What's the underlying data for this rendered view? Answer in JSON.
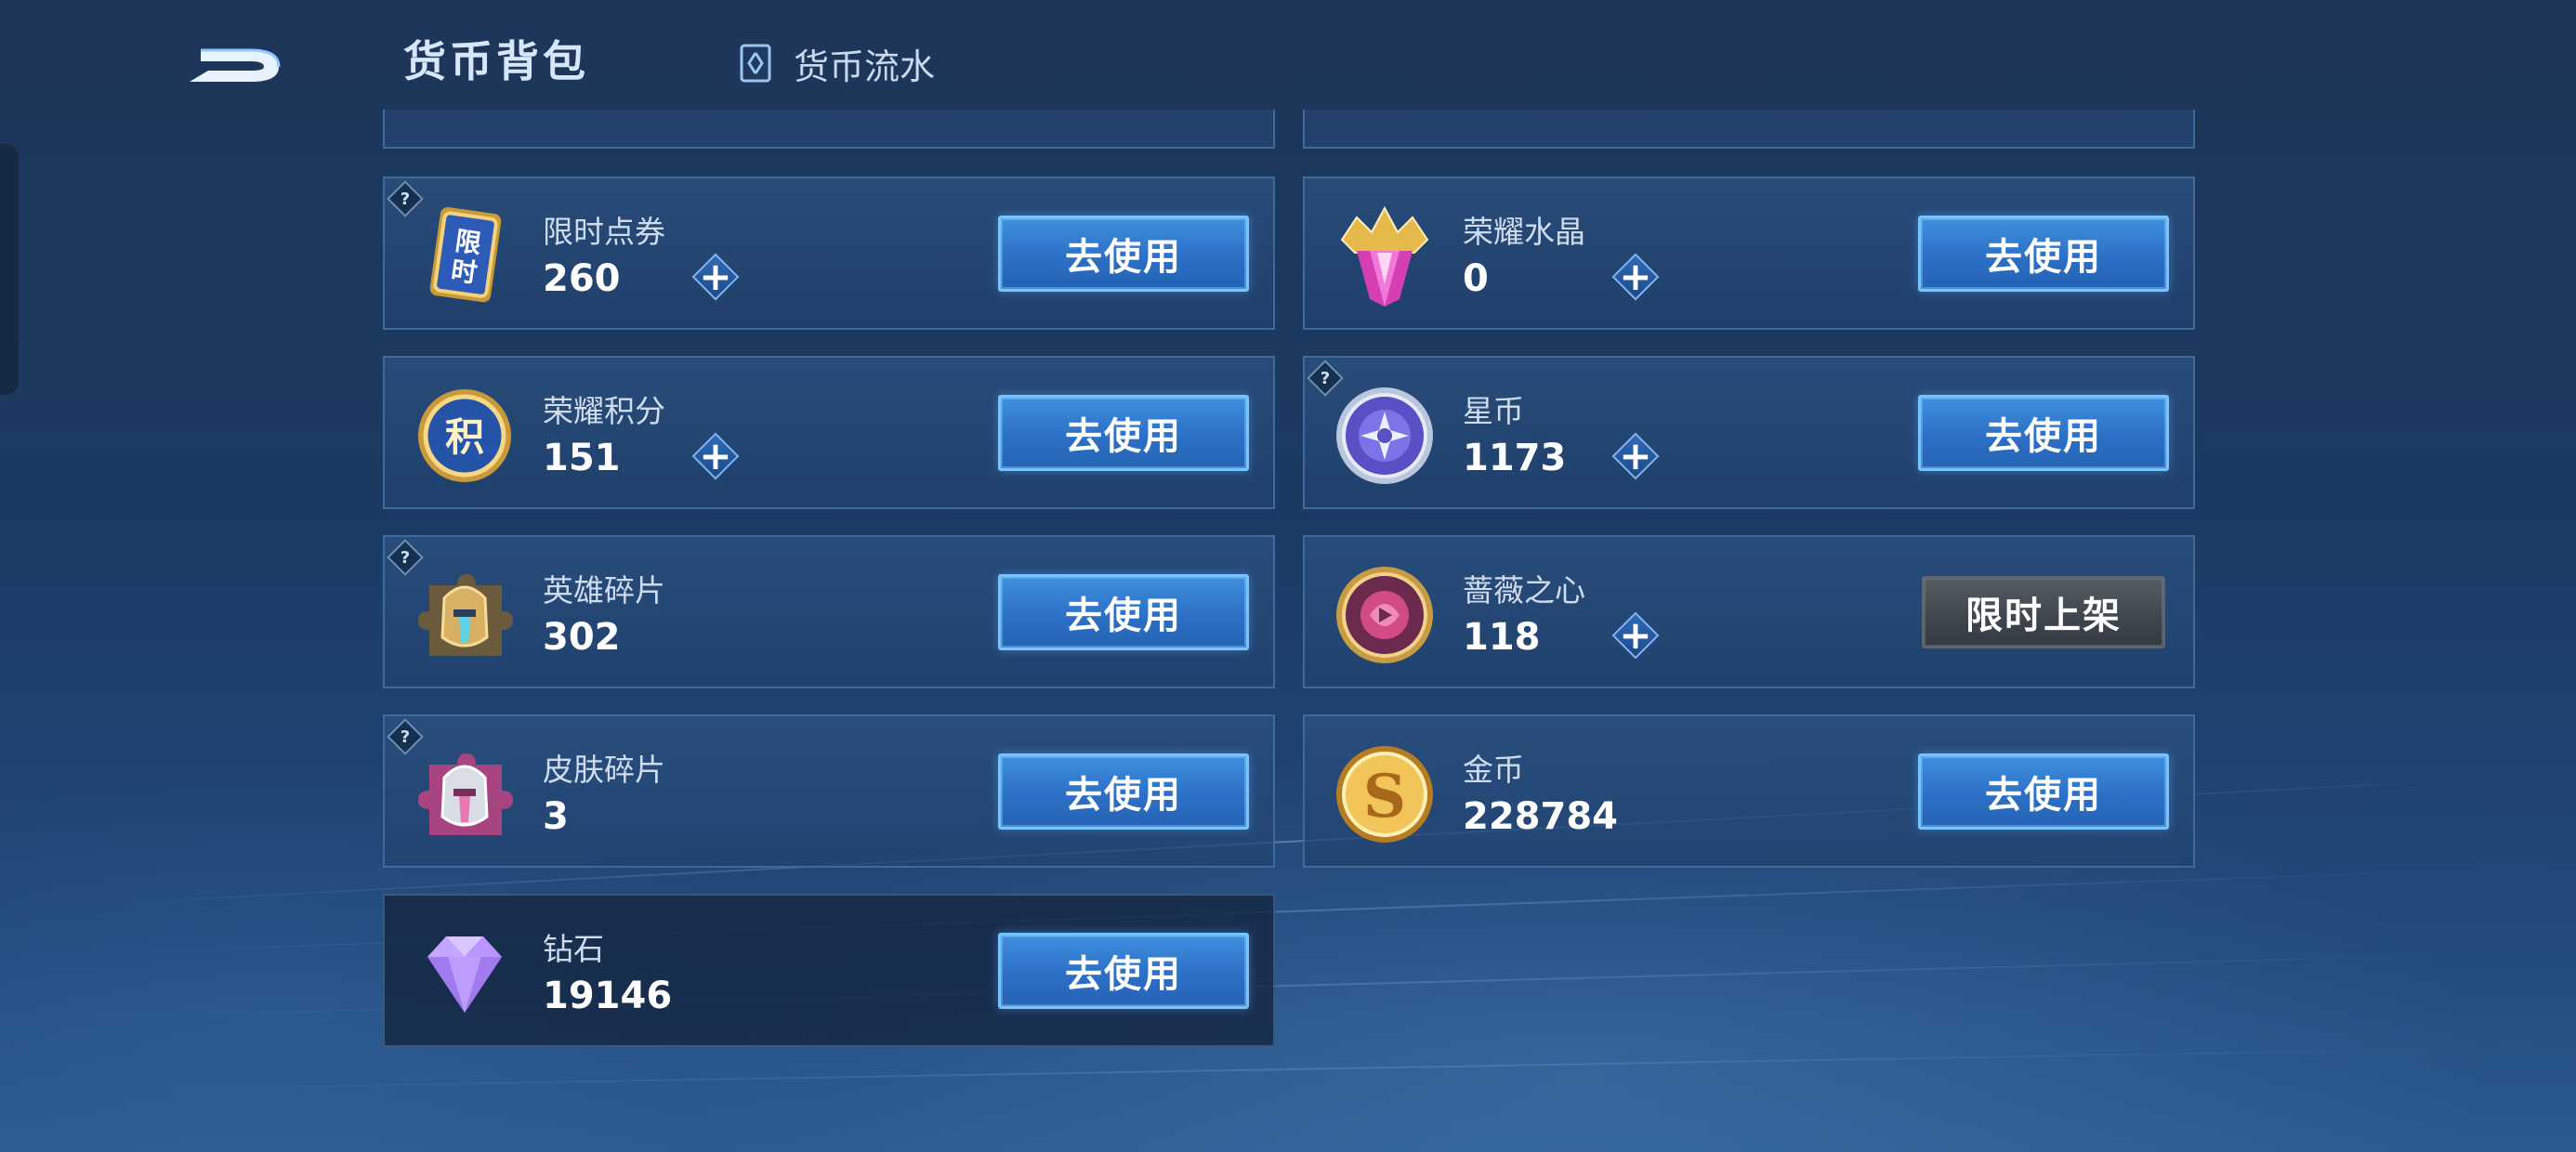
{
  "header": {
    "title": "货币背包",
    "flow_tab_label": "货币流水"
  },
  "help_mark": "?",
  "plus_symbol": "+",
  "colors": {
    "accent_button": "#2c70c6",
    "accent_border": "#74c4ff",
    "card_border": "#3f6a9c",
    "disabled_button": "#3e454d"
  },
  "currencies": [
    {
      "name": "限时点券",
      "amount": "260",
      "icon": "limited-coupon-icon",
      "button": "去使用",
      "has_help": true,
      "has_plus": true
    },
    {
      "name": "荣耀水晶",
      "amount": "0",
      "icon": "glory-crystal-icon",
      "button": "去使用",
      "has_help": false,
      "has_plus": true
    },
    {
      "name": "荣耀积分",
      "amount": "151",
      "icon": "glory-points-icon",
      "button": "去使用",
      "has_help": false,
      "has_plus": true
    },
    {
      "name": "星币",
      "amount": "1173",
      "icon": "star-coin-icon",
      "button": "去使用",
      "has_help": true,
      "has_plus": true
    },
    {
      "name": "英雄碎片",
      "amount": "302",
      "icon": "hero-fragment-icon",
      "button": "去使用",
      "has_help": true,
      "has_plus": false
    },
    {
      "name": "蔷薇之心",
      "amount": "118",
      "icon": "rose-heart-icon",
      "button": "限时上架",
      "has_help": false,
      "has_plus": true
    },
    {
      "name": "皮肤碎片",
      "amount": "3",
      "icon": "skin-fragment-icon",
      "button": "去使用",
      "has_help": true,
      "has_plus": false
    },
    {
      "name": "金币",
      "amount": "228784",
      "icon": "gold-coin-icon",
      "button": "去使用",
      "has_help": false,
      "has_plus": false
    },
    {
      "name": "钻石",
      "amount": "19146",
      "icon": "diamond-icon",
      "button": "去使用",
      "has_help": false,
      "has_plus": false
    }
  ]
}
